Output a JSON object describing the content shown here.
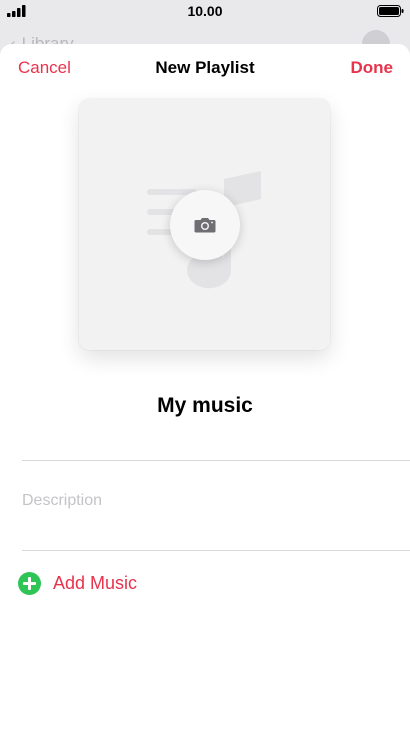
{
  "status_bar": {
    "time": "10.00",
    "signal_icon": "cellular-signal-icon",
    "battery_icon": "battery-full-icon"
  },
  "background_page": {
    "back_label": "Library",
    "back_icon": "chevron-left-icon"
  },
  "nav": {
    "cancel_label": "Cancel",
    "title": "New Playlist",
    "done_label": "Done"
  },
  "artwork": {
    "placeholder_icon": "music-note-placeholder-icon",
    "camera_icon": "camera-icon"
  },
  "playlist": {
    "name": "My music",
    "description_placeholder": "Description"
  },
  "add_music": {
    "label": "Add Music",
    "icon": "plus-circle-icon"
  },
  "colors": {
    "accent": "#e8334c",
    "add_green": "#2fc556",
    "sheet_background": "#ffffff",
    "backdrop": "#e9e9ec"
  }
}
